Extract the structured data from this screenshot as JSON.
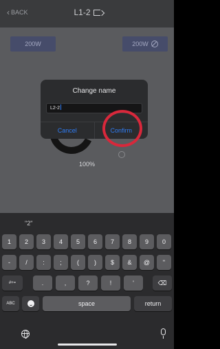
{
  "nav": {
    "back_label": "BACK",
    "title": "L1-2"
  },
  "chips": {
    "left": "200W",
    "right": "200W"
  },
  "dial": {
    "percent": "100%"
  },
  "dialog": {
    "title": "Change name",
    "input_value": "L2-2",
    "cancel_label": "Cancel",
    "confirm_label": "Confirm"
  },
  "highlight_color": "#d8283b",
  "keyboard": {
    "suggestion": "\"2\"",
    "row1": [
      "1",
      "2",
      "3",
      "4",
      "5",
      "6",
      "7",
      "8",
      "9",
      "0"
    ],
    "row2": [
      "-",
      "/",
      ":",
      ";",
      "(",
      ")",
      "$",
      "&",
      "@",
      "\""
    ],
    "row3": [
      ".",
      ",",
      "?",
      "!",
      "'"
    ],
    "shift_label": "#+=",
    "delete_icon": "backspace-icon",
    "abc_label": "ABC",
    "space_label": "space",
    "return_label": "return"
  }
}
